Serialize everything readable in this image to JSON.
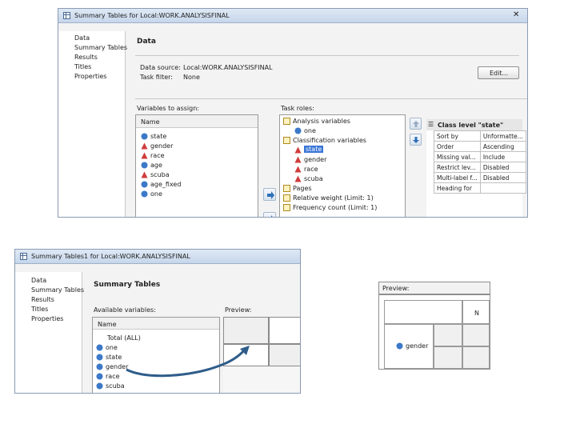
{
  "top_window": {
    "title": "Summary Tables for Local:WORK.ANALYSISFINAL",
    "close_glyph": "✕",
    "nav": [
      "Data",
      "Summary Tables",
      "Results",
      "Titles",
      "Properties"
    ],
    "section_title": "Data",
    "data_source_label": "Data source:",
    "data_source_value": "Local:WORK.ANALYSISFINAL",
    "task_filter_label": "Task filter:",
    "task_filter_value": "None",
    "edit_button": "Edit...",
    "vars_label": "Variables to assign:",
    "vars_header": "Name",
    "vars": [
      "state",
      "gender",
      "race",
      "age",
      "scuba",
      "age_fixed",
      "one"
    ],
    "roles_label": "Task roles:",
    "roles": {
      "analysis": "Analysis variables",
      "analysis_item": "one",
      "classification": "Classification variables",
      "class_items": [
        "state",
        "gender",
        "race",
        "scuba"
      ],
      "pages": "Pages",
      "relative_weight": "Relative weight  (Limit: 1)",
      "frequency_count": "Frequency count  (Limit: 1)"
    },
    "props_title": "Class level \"state\"",
    "props": [
      [
        "Sort by",
        "Unformatte..."
      ],
      [
        "Order",
        "Ascending"
      ],
      [
        "Missing val...",
        "Include"
      ],
      [
        "Restrict lev...",
        "Disabled"
      ],
      [
        "Multi-label f...",
        "Disabled"
      ],
      [
        "Heading for",
        ""
      ]
    ]
  },
  "bottom_window": {
    "title": "Summary Tables1 for Local:WORK.ANALYSISFINAL",
    "nav": [
      "Data",
      "Summary Tables",
      "Results",
      "Titles",
      "Properties"
    ],
    "section_title": "Summary Tables",
    "avail_label": "Available variables:",
    "avail_header": "Name",
    "avail_vars": [
      "Total (ALL)",
      "one",
      "state",
      "gender",
      "race",
      "scuba"
    ],
    "preview_label": "Preview:"
  },
  "preview_zoom": {
    "label": "Preview:",
    "n_header": "N",
    "row_var": "gender"
  },
  "colors": {
    "accent": "#3875d7",
    "arrow": "#2f5d8a",
    "classvar_icon": "#d03c3c",
    "numvar_icon": "#3c78c8"
  }
}
